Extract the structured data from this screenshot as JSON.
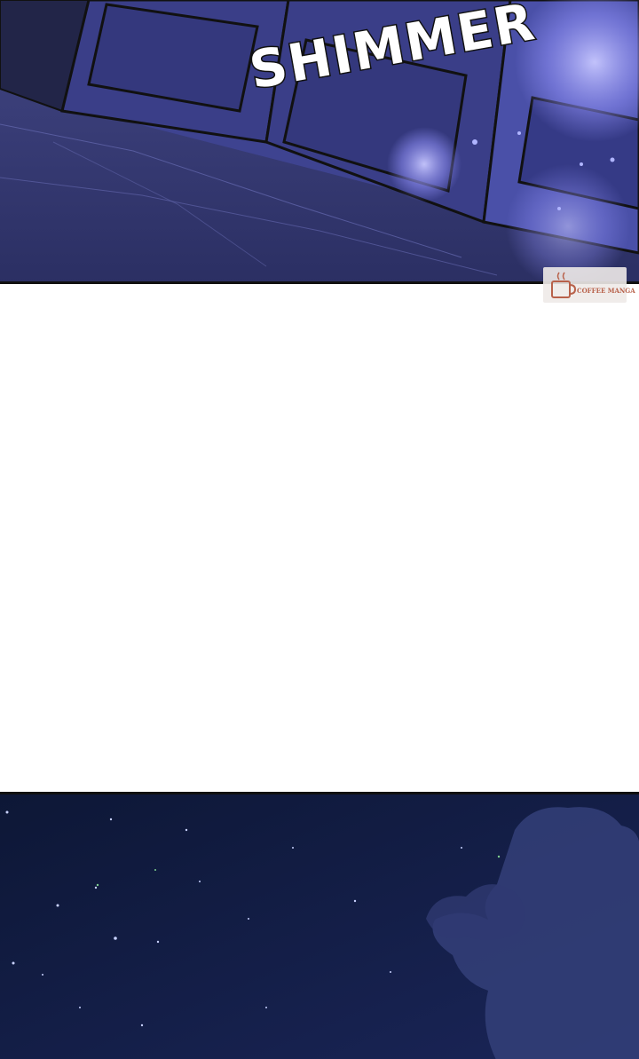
{
  "sfx": {
    "text": "SHIMMER"
  },
  "watermark": {
    "text": "COFFEE MANGA"
  },
  "colors": {
    "night_purple": "#2a2d63",
    "night_navy": "#0f1a3f",
    "glow": "#8e8ef5",
    "watermark_brown": "#b8614a"
  }
}
